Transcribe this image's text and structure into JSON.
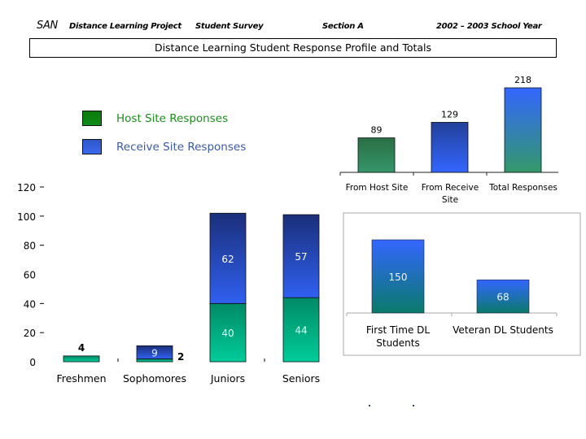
{
  "header": {
    "brand": "SAN",
    "project": "Distance Learning Project",
    "survey": "Student Survey",
    "section": "Section A",
    "year": "2002 – 2003 School Year"
  },
  "title": "Distance Learning Student Response Profile and Totals",
  "legend": {
    "items": [
      {
        "label": "Host Site Responses",
        "color": "#0a7a0a",
        "text_color": "#1e8c1e"
      },
      {
        "label": "Receive Site Responses",
        "color": "#3060e0",
        "text_color": "#3a5aa8"
      }
    ]
  },
  "chart_data": [
    {
      "type": "bar",
      "stacked": true,
      "title": "",
      "categories": [
        "Freshmen",
        "Sophomores",
        "Juniors",
        "Seniors"
      ],
      "series": [
        {
          "name": "Host Site Responses",
          "values": [
            4,
            2,
            40,
            44
          ],
          "labels": [
            "4",
            "2",
            "40",
            "44"
          ]
        },
        {
          "name": "Receive Site Responses",
          "values": [
            0,
            9,
            62,
            57
          ],
          "labels": [
            "",
            "9",
            "62",
            "57"
          ]
        }
      ],
      "yticks": [
        0,
        20,
        40,
        60,
        80,
        100,
        120
      ],
      "ylim": [
        0,
        120
      ],
      "xlabel": "",
      "ylabel": "",
      "grid": false
    },
    {
      "type": "bar",
      "title": "",
      "categories": [
        "From Host Site",
        "From Receive Site",
        "Total Responses"
      ],
      "values": [
        89,
        129,
        218
      ],
      "labels": [
        "89",
        "129",
        "218"
      ],
      "ylim": [
        0,
        218
      ],
      "grid": false
    },
    {
      "type": "bar",
      "title": "",
      "categories": [
        "First Time DL Students",
        "Veteran DL Students"
      ],
      "values": [
        150,
        68
      ],
      "labels": [
        "150",
        "68"
      ],
      "ylim": [
        0,
        160
      ],
      "grid": false
    }
  ],
  "colors": {
    "green_top": "#007a5a",
    "green_bottom": "#00cc99",
    "blue_top": "#1a2f7a",
    "blue_mid": "#2e5de8",
    "host_green": "#2e7d4e",
    "teal": "#0a7a6a"
  }
}
